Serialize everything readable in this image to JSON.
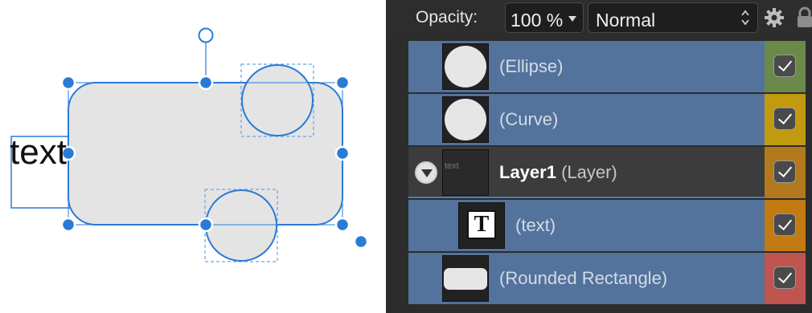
{
  "canvas": {
    "text_object": "text",
    "colors": {
      "selection": "#2a7bd6",
      "shape_fill": "#e4e4e4"
    }
  },
  "toolbar": {
    "opacity_label": "Opacity:",
    "opacity_value": "100 %",
    "blend_mode": "Normal",
    "icons": [
      "chevron-down-icon",
      "up-down-arrows-icon",
      "gear-icon",
      "lock-icon"
    ]
  },
  "layers": [
    {
      "name": "(Ellipse)",
      "visible": true,
      "tag_color": "#6b8a4a",
      "thumb": "ellipse"
    },
    {
      "name": "(Curve)",
      "visible": true,
      "tag_color": "#c29a10",
      "thumb": "curve"
    },
    {
      "name": "Layer1",
      "type": "(Layer)",
      "visible": true,
      "tag_color": "#b27a1c",
      "thumb_text": "text",
      "expanded": true
    },
    {
      "name": "(text)",
      "visible": true,
      "tag_color": "#c27a12",
      "thumb": "text"
    },
    {
      "name": "(Rounded Rectangle)",
      "visible": true,
      "tag_color": "#c0544e",
      "thumb": "rounded-rectangle"
    }
  ]
}
